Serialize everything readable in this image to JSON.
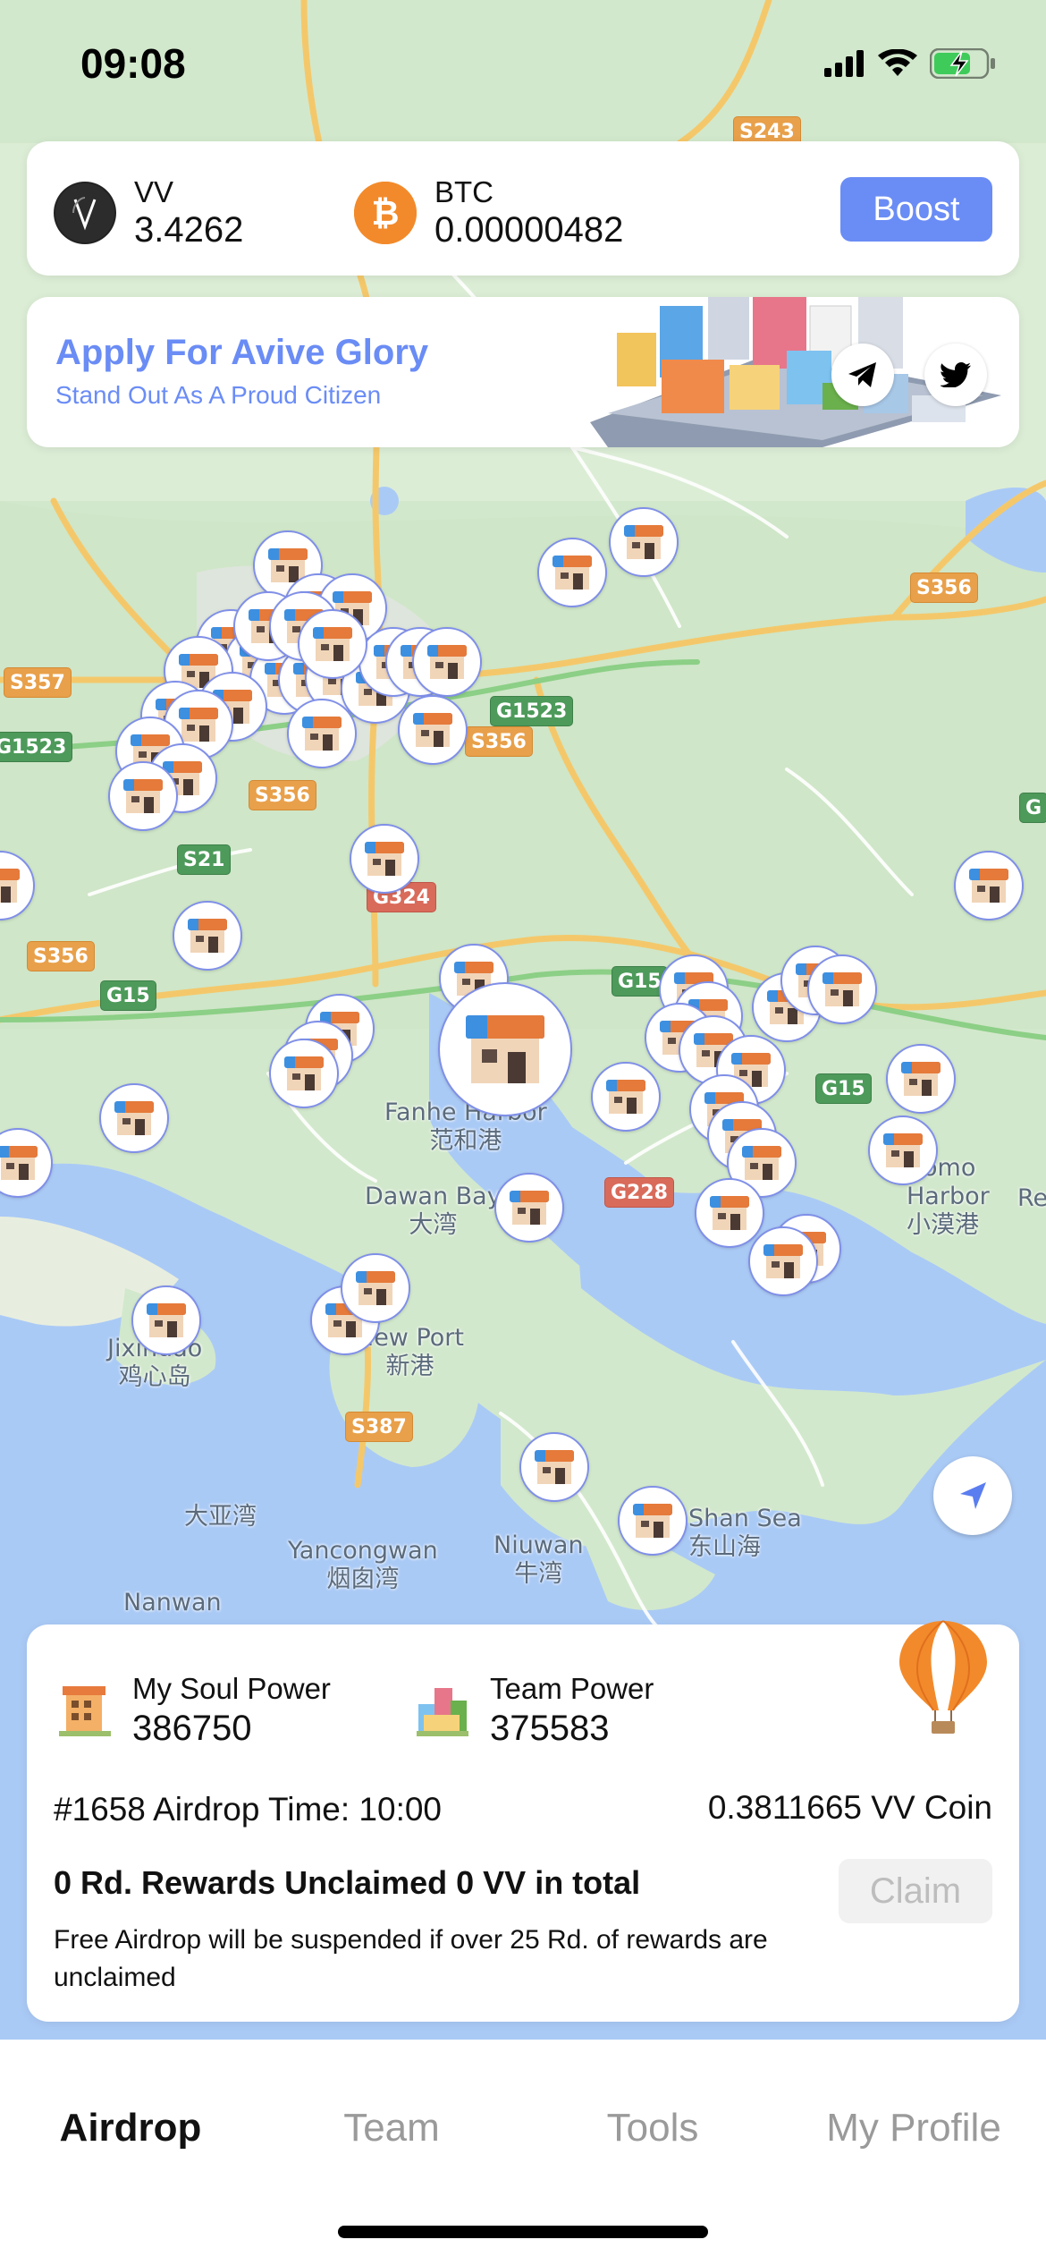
{
  "status": {
    "time": "09:08",
    "icons": [
      "signal-icon",
      "wifi-icon",
      "battery-charging-icon"
    ]
  },
  "balances": {
    "vv": {
      "symbol": "VV",
      "amount": "3.4262",
      "icon": "vv-logo"
    },
    "btc": {
      "symbol": "BTC",
      "amount": "0.00000482",
      "icon": "bitcoin-logo"
    },
    "boost_label": "Boost"
  },
  "banner": {
    "title": "Apply For Avive Glory",
    "subtitle": "Stand Out As A Proud Citizen",
    "social": [
      "telegram-icon",
      "twitter-icon"
    ]
  },
  "map": {
    "labels": {
      "fanhe_en": "Fanhe Harbor",
      "fanhe_zh": "范和港",
      "dawan_en": "Dawan Bay",
      "dawan_zh": "大湾",
      "newport_en": "New Port",
      "newport_zh": "新港",
      "jixindao_en": "Jixindao",
      "jixindao_zh": "鸡心岛",
      "dayawan": "大亚湾",
      "yancongwan_en": "Yancongwan",
      "yancongwan_zh": "烟囱湾",
      "niuwan_en": "Niuwan",
      "niuwan_zh": "牛湾",
      "nanwan": "Nanwan",
      "aomo_en": "Aomo",
      "aomo_harbor": "Harbor",
      "aomo_zh": "小漠港",
      "re": "Re",
      "shan_sea_en": "Shan Sea",
      "shan_sea_zh": "东山海"
    },
    "shields": {
      "s243": "S243",
      "s356a": "S356",
      "s357": "S357",
      "g1523a": "G1523",
      "g1523b": "G1523",
      "s356b": "S356",
      "s356c": "S356",
      "s21": "S21",
      "g324": "G324",
      "s356d": "S356",
      "g15a": "G15",
      "g15b": "G15",
      "g15c": "G15",
      "g228": "G228",
      "s387": "S387",
      "g_edge": "G"
    }
  },
  "power": {
    "soul_label": "My Soul Power",
    "soul_value": "386750",
    "team_label": "Team Power",
    "team_value": "375583",
    "airdrop_time": "#1658 Airdrop Time: 10:00",
    "vv_coin": "0.3811665 VV Coin",
    "unclaimed": "0 Rd. Rewards Unclaimed 0 VV in total",
    "claim_label": "Claim",
    "warning": "Free Airdrop will be suspended if over 25 Rd. of rewards are unclaimed"
  },
  "tabs": [
    {
      "label": "Airdrop",
      "active": true
    },
    {
      "label": "Team",
      "active": false
    },
    {
      "label": "Tools",
      "active": false
    },
    {
      "label": "My Profile",
      "active": false
    }
  ]
}
